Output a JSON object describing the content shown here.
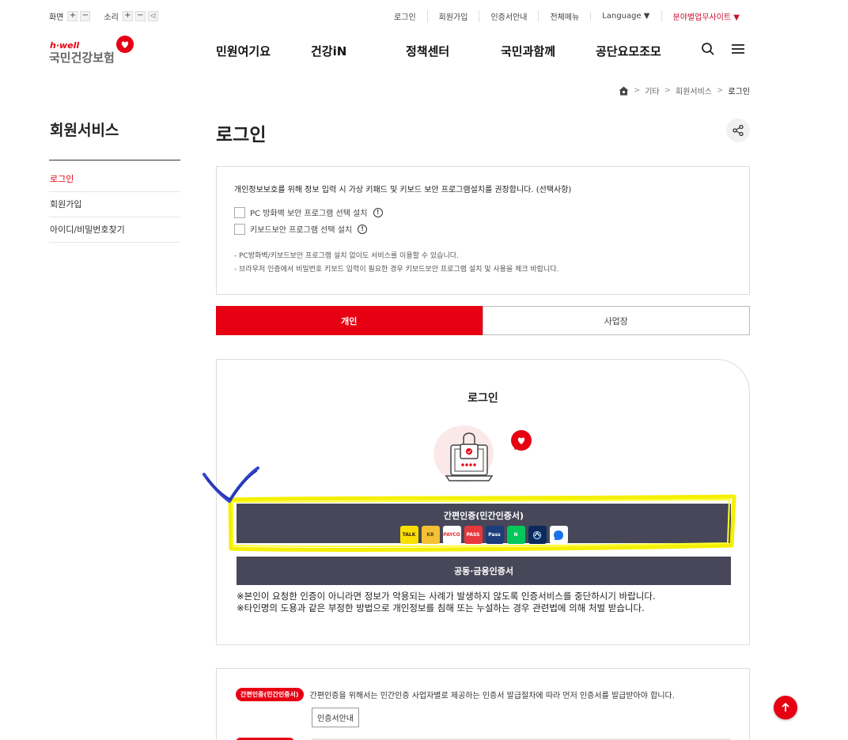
{
  "utility": {
    "screen_label": "화면",
    "sound_label": "소리",
    "links": [
      "로그인",
      "회원가입",
      "인증서안내",
      "전체메뉴",
      "Language ▼",
      "분야별업무사이트 ▼"
    ]
  },
  "logo": {
    "hwell": "h·well",
    "name": "국민건강보험"
  },
  "gnb": [
    "민원여기요",
    "건강iN",
    "정책센터",
    "국민과함께",
    "공단요모조모"
  ],
  "breadcrumb": {
    "items": [
      "기타",
      "회원서비스"
    ],
    "current": "로그인"
  },
  "sidebar": {
    "title": "회원서비스",
    "items": [
      {
        "label": "로그인",
        "active": true
      },
      {
        "label": "회원가입",
        "active": false
      },
      {
        "label": "아이디/비밀번호찾기",
        "active": false
      }
    ]
  },
  "page_title": "로그인",
  "notice": {
    "lead": "개인정보보호를 위해 정보 입력 시 가상 키패드 및 키보드 보안 프로그램설치를 권장합니다. (선택사항)",
    "checks": [
      "PC 방화벽 보안 프로그램 선택 설치",
      "키보드보안 프로그램 선택 설치"
    ],
    "bullets": [
      "- PC방화벽/키보드보안 프로그램 설치 없이도 서비스를 이용할 수 있습니다.",
      "- 브라우저 인증에서 비밀번호 키보드 입력이 필요한 경우 키보드보안 프로그램 설치 및 사용을 체크 바랍니다."
    ]
  },
  "tabs": [
    {
      "label": "개인",
      "active": true
    },
    {
      "label": "사업장",
      "active": false
    }
  ],
  "login_card": {
    "title": "로그인",
    "easy_auth_label": "간편인증(민간인증서)",
    "providers": [
      {
        "text": "TALK",
        "bg": "#f9e000",
        "fg": "#3a1d1d"
      },
      {
        "text": "KB",
        "bg": "#f5c033",
        "fg": "#5a4a1a"
      },
      {
        "text": "PAYCO",
        "bg": "#ffffff",
        "fg": "#e0302c"
      },
      {
        "text": "PASS",
        "bg": "#e8383d",
        "fg": "#ffffff"
      },
      {
        "text": "Pass",
        "bg": "#1c3c7c",
        "fg": "#ffffff"
      },
      {
        "text": "N",
        "bg": "#03c75a",
        "fg": "#ffffff"
      },
      {
        "text": "",
        "bg": "#0b2a5c",
        "fg": "#ffffff"
      },
      {
        "text": "",
        "bg": "#ffffff",
        "fg": "#1a73e8"
      }
    ],
    "cert_label": "공동·금융인증서",
    "warnings": [
      "※본인이 요청한 인증이 아니라면 정보가 악용되는 사례가 발생하지 않도록 인증서비스를 중단하시기 바랍니다.",
      "※타인명의 도용과 같은 부정한 방법으로 개인정보를 침해 또는 누설하는 경우 관련법에 의해 처벌 받습니다."
    ]
  },
  "info": {
    "tag": "간편인증(민간인증서)",
    "text": "간편인증을 위해서는 민간인증 사업자별로 제공하는 인증서 발급절차에 따라 먼저 인증서를 발급받아야 합니다.",
    "button": "인증서안내"
  },
  "colors": {
    "brand_red": "#e60012",
    "button_dark": "#474759",
    "highlight_yellow": "#ffff00",
    "annotation_blue": "#3344cc"
  }
}
